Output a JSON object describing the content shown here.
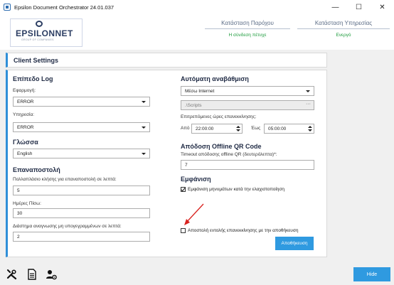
{
  "window": {
    "title": "Epsilon Document Orchestrator 24.01.037",
    "minimize_glyph": "—",
    "maximize_glyph": "☐",
    "close_glyph": "✕"
  },
  "header": {
    "logo_text": "EPSILONNET",
    "logo_subtext": "GROUP OF COMPANIES",
    "provider_status_label": "Κατάσταση Παρόχου",
    "provider_status_value": "Η σύνδεση πέτυχε",
    "service_status_label": "Κατάσταση Υπηρεσίας",
    "service_status_value": "Ενεργό",
    "status_color": "#1a9a3a"
  },
  "client_settings": {
    "title": "Client Settings"
  },
  "log_level": {
    "title": "Επίπεδο Log",
    "application_label": "Εφαρμογή:",
    "application_value": "ERROR",
    "service_label": "Υπηρεσία:",
    "service_value": "ERROR"
  },
  "language": {
    "title": "Γλώσσα",
    "value": "English"
  },
  "resend": {
    "title": "Επαναποστολή",
    "interval_label": "Πολλαπλάσιο κλήσης για επαναποστολή σε λεπτά:",
    "interval_value": "5",
    "days_back_label": "Ημέρες Πίσω:",
    "days_back_value": "30",
    "unsigned_interval_label": "Διάστημα αναγνωσης μη υπογεγραμμένων σε λεπτά:",
    "unsigned_interval_value": "2"
  },
  "auto_update": {
    "title": "Αυτόματη αναβάθμιση",
    "method_value": "Μέσω Internet",
    "scripts_path": ".\\Scripts",
    "browse_glyph": "···",
    "allowed_hours_label": "Επιτρεπόμενες ώρες επανεκκίνησης:",
    "from_label": "Από",
    "from_value": "22:00:00",
    "to_label": "Έως",
    "to_value": "05:00:00"
  },
  "offline_qr": {
    "title": "Απόδοση Offline QR Code",
    "timeout_label": "Timeout απόδοσης offline QR (δευτερόλεπτα)*:",
    "timeout_value": "7"
  },
  "display": {
    "title": "Εμφάνιση",
    "show_messages_label": "Εμφάνιση μηνυμάτων κατά την ελαχιστοποίηση",
    "show_messages_checked": true
  },
  "restart": {
    "send_restart_label": "Αποστολή εντολής επανεκκίνησης με την αποθήκευση",
    "send_restart_checked": false
  },
  "actions": {
    "save_label": "Αποθήκευση",
    "hide_label": "Hide"
  },
  "colors": {
    "accent": "#2f9ae0",
    "panel_border": "#2f8fd8",
    "annotation_arrow": "#d9231f"
  },
  "icons": {
    "tools": "tools-icon",
    "document": "document-icon",
    "user_settings": "user-settings-icon"
  }
}
